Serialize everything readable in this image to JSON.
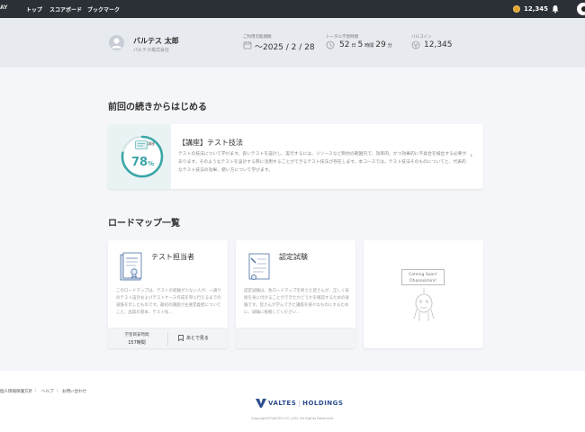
{
  "topbar": {
    "brand_fragment": "AY",
    "nav": [
      {
        "label": "トップ"
      },
      {
        "label": "スコアボード"
      },
      {
        "label": "ブックマーク"
      }
    ],
    "coins": "12,345"
  },
  "profile": {
    "name": "バルテス 太郎",
    "company": "バルテス株式会社",
    "period_label": "ご利用可能期間",
    "period_value": "～2025 / 2 / 28",
    "study_label": "トータル学習時間",
    "study_days": "52",
    "study_days_unit": "日",
    "study_hours": "5",
    "study_hours_unit": "時間",
    "study_minutes": "29",
    "study_minutes_unit": "分",
    "coin_label": "バルコイン",
    "coin_value": "12,345"
  },
  "resume": {
    "section_title": "前回の続きからはじめる",
    "badge_label": "講座",
    "progress_percent": 78,
    "progress_text": "78",
    "progress_unit": "%",
    "course_title": "【講座】テスト技法",
    "course_description": "テストの技法について学びます。良いテストを設計し、実行するには、リソースなど制約の範囲内で、効率的、かつ効果的に不具合を検出する必要があります。そのようなテストを設計する際に活用することができるテスト技法が存在します。本コースでは、テスト技法そのものについてと、代表的なテスト技法の効果、使い方について学びます。"
  },
  "roadmap": {
    "section_title": "ロードマップ一覧",
    "cards": [
      {
        "title": "テスト担当者",
        "description": "このロードマップは、テストの経験が少ない人が、一通りのテスト設計およびテストケース作成を単に行えるまでの道筋を示したものです。最初の講座が主要定義者についてこと、品質の基本、テスト技…",
        "time_label": "学習目安時間",
        "time_value": "157時間",
        "later_label": "あとで見る"
      },
      {
        "title": "認定試験",
        "description": "認定試験は、各ロードマップを終えた皆さんが、正しく技術を身に付けることができたかどうかを確認するための試験です。皆さんが学んできた講座を様々なものにするために、試験に挑戦してください…"
      }
    ],
    "coming_soon_line1": "Coming Soon!",
    "coming_soon_line2": "Ohanosimini!"
  },
  "footer": {
    "links": [
      {
        "label": "個人情報保護方針"
      },
      {
        "label": "ヘルプ"
      },
      {
        "label": "お問い合わせ"
      }
    ],
    "logo_main": "VALTES",
    "logo_sub": "HOLDINGS",
    "copyright": "Copyright©VALTES CO.,LTD. All Rights Reserved."
  },
  "colors": {
    "accent_teal": "#3aa6a8",
    "topbar": "#2b2f36",
    "brand_blue": "#2d4f8f"
  }
}
